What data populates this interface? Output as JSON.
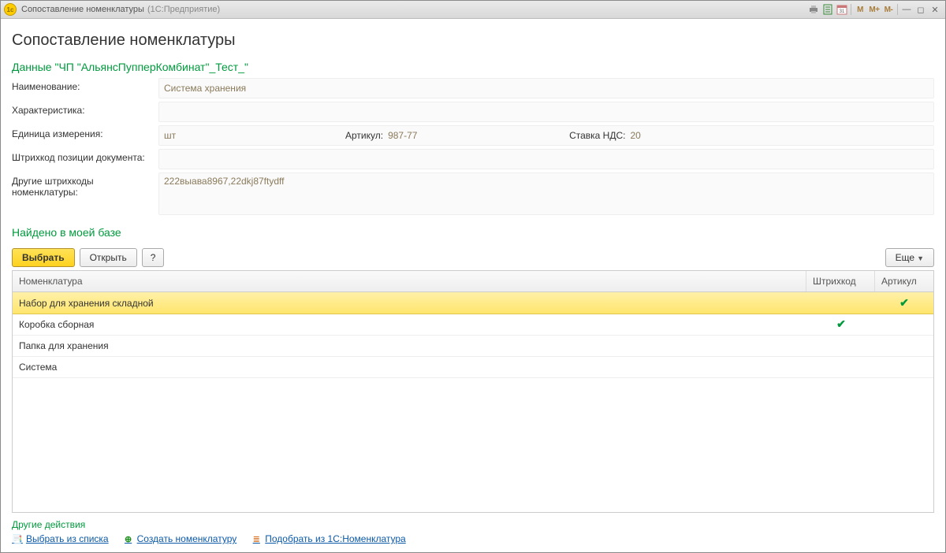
{
  "window": {
    "title": "Сопоставление номенклатуры",
    "subtitle": "(1С:Предприятие)"
  },
  "heading": "Сопоставление номенклатуры",
  "source_section": {
    "title": "Данные \"ЧП \"АльянсПупперКомбинат\"_Тест_\"",
    "fields": {
      "name_label": "Наименование:",
      "name_value": "Система хранения",
      "char_label": "Характеристика:",
      "char_value": "",
      "unit_label": "Единица измерения:",
      "unit_value": "шт",
      "article_label": "Артикул:",
      "article_value": "987-77",
      "vat_label": "Ставка НДС:",
      "vat_value": "20",
      "doc_barcode_label": "Штрихкод позиции документа:",
      "doc_barcode_value": "",
      "other_barcodes_label": "Другие штрихкоды номенклатуры:",
      "other_barcodes_value": "222выава8967,22dkj87ftydff"
    }
  },
  "found_section": {
    "title": "Найдено в моей базе",
    "buttons": {
      "select": "Выбрать",
      "open": "Открыть",
      "help": "?",
      "more": "Еще"
    },
    "columns": {
      "name": "Номенклатура",
      "barcode": "Штрихкод",
      "article": "Артикул"
    },
    "rows": [
      {
        "name": "Набор для хранения складной",
        "barcode": false,
        "article": true,
        "selected": true
      },
      {
        "name": "Коробка сборная",
        "barcode": true,
        "article": false,
        "selected": false
      },
      {
        "name": "Папка для хранения",
        "barcode": false,
        "article": false,
        "selected": false
      },
      {
        "name": "Система",
        "barcode": false,
        "article": false,
        "selected": false
      }
    ]
  },
  "footer": {
    "title": "Другие действия",
    "links": {
      "pick_list": "Выбрать из списка",
      "create": "Создать номенклатуру",
      "pick_1c": "Подобрать из 1С:Номенклатура"
    }
  },
  "titlebar_labels": {
    "m": "M",
    "mplus": "M+",
    "mminus": "M-"
  }
}
